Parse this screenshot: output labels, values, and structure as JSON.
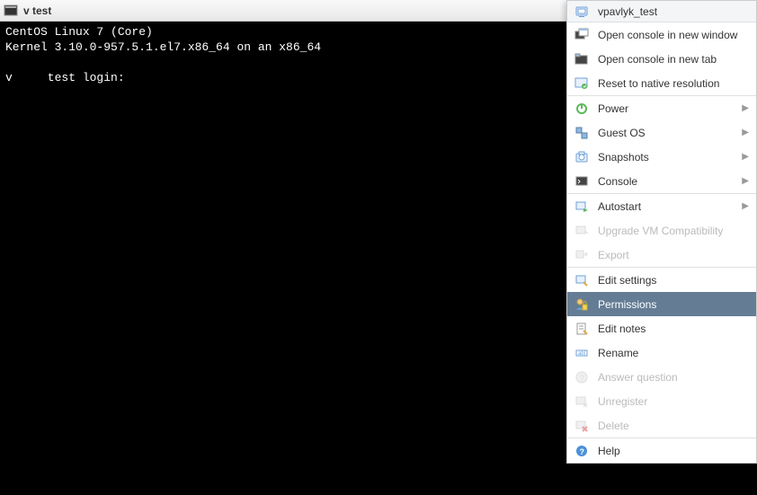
{
  "window": {
    "title": "v       test"
  },
  "console": {
    "line1": "CentOS Linux 7 (Core)",
    "line2": "Kernel 3.10.0-957.5.1.el7.x86_64 on an x86_64",
    "line3": "",
    "line4": "v     test login:"
  },
  "menu": {
    "header": "vpavlyk_test",
    "items": {
      "open_new_window": "Open console in new window",
      "open_new_tab": "Open console in new tab",
      "reset_resolution": "Reset to native resolution",
      "power": "Power",
      "guest_os": "Guest OS",
      "snapshots": "Snapshots",
      "console": "Console",
      "autostart": "Autostart",
      "upgrade": "Upgrade VM Compatibility",
      "export": "Export",
      "edit_settings": "Edit settings",
      "permissions": "Permissions",
      "edit_notes": "Edit notes",
      "rename": "Rename",
      "answer_question": "Answer question",
      "unregister": "Unregister",
      "delete": "Delete",
      "help": "Help"
    }
  }
}
